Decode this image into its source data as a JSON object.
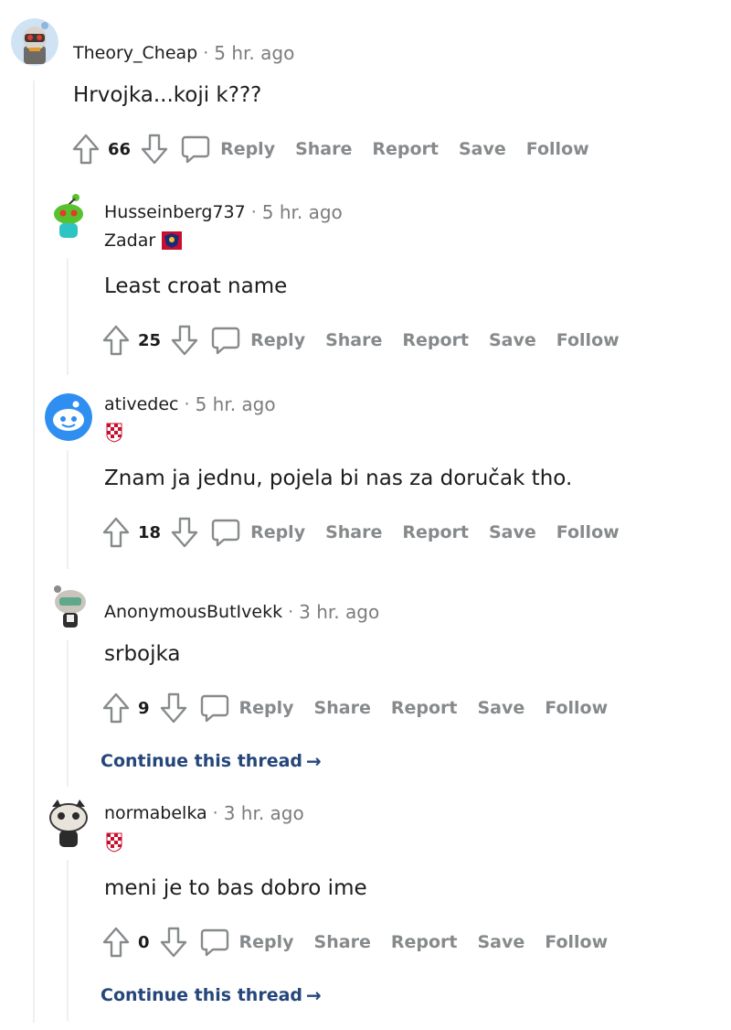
{
  "actions": {
    "reply": "Reply",
    "share": "Share",
    "report": "Report",
    "save": "Save",
    "follow": "Follow"
  },
  "continue_thread": "Continue this thread",
  "comments": [
    {
      "username": "Theory_Cheap",
      "time": "5 hr. ago",
      "flair": "",
      "body": "Hrvojka...koji k???",
      "score": "66",
      "avatar": "robot-avatar-icon"
    },
    {
      "username": "Husseinberg737",
      "time": "5 hr. ago",
      "flair": "Zadar",
      "body": "Least croat name",
      "score": "25",
      "avatar": "green-snoo-avatar-icon"
    },
    {
      "username": "ativedec",
      "time": "5 hr. ago",
      "flair": "",
      "body": "Znam ja jednu, pojela bi nas za doručak tho.",
      "score": "18",
      "avatar": "default-snoo-avatar-icon"
    },
    {
      "username": "AnonymousButIvekk",
      "time": "3 hr. ago",
      "flair": "",
      "body": "srbojka",
      "score": "9",
      "avatar": "masked-snoo-avatar-icon"
    },
    {
      "username": "normabelka",
      "time": "3 hr. ago",
      "flair": "",
      "body": "meni je to bas dobro ime",
      "score": "0",
      "avatar": "cat-snoo-avatar-icon"
    }
  ],
  "colors": {
    "text": "#1c1c1c",
    "meta": "#7c7c7c",
    "action": "#878a8c",
    "link": "#24467a",
    "thread_line": "#edeff1"
  }
}
